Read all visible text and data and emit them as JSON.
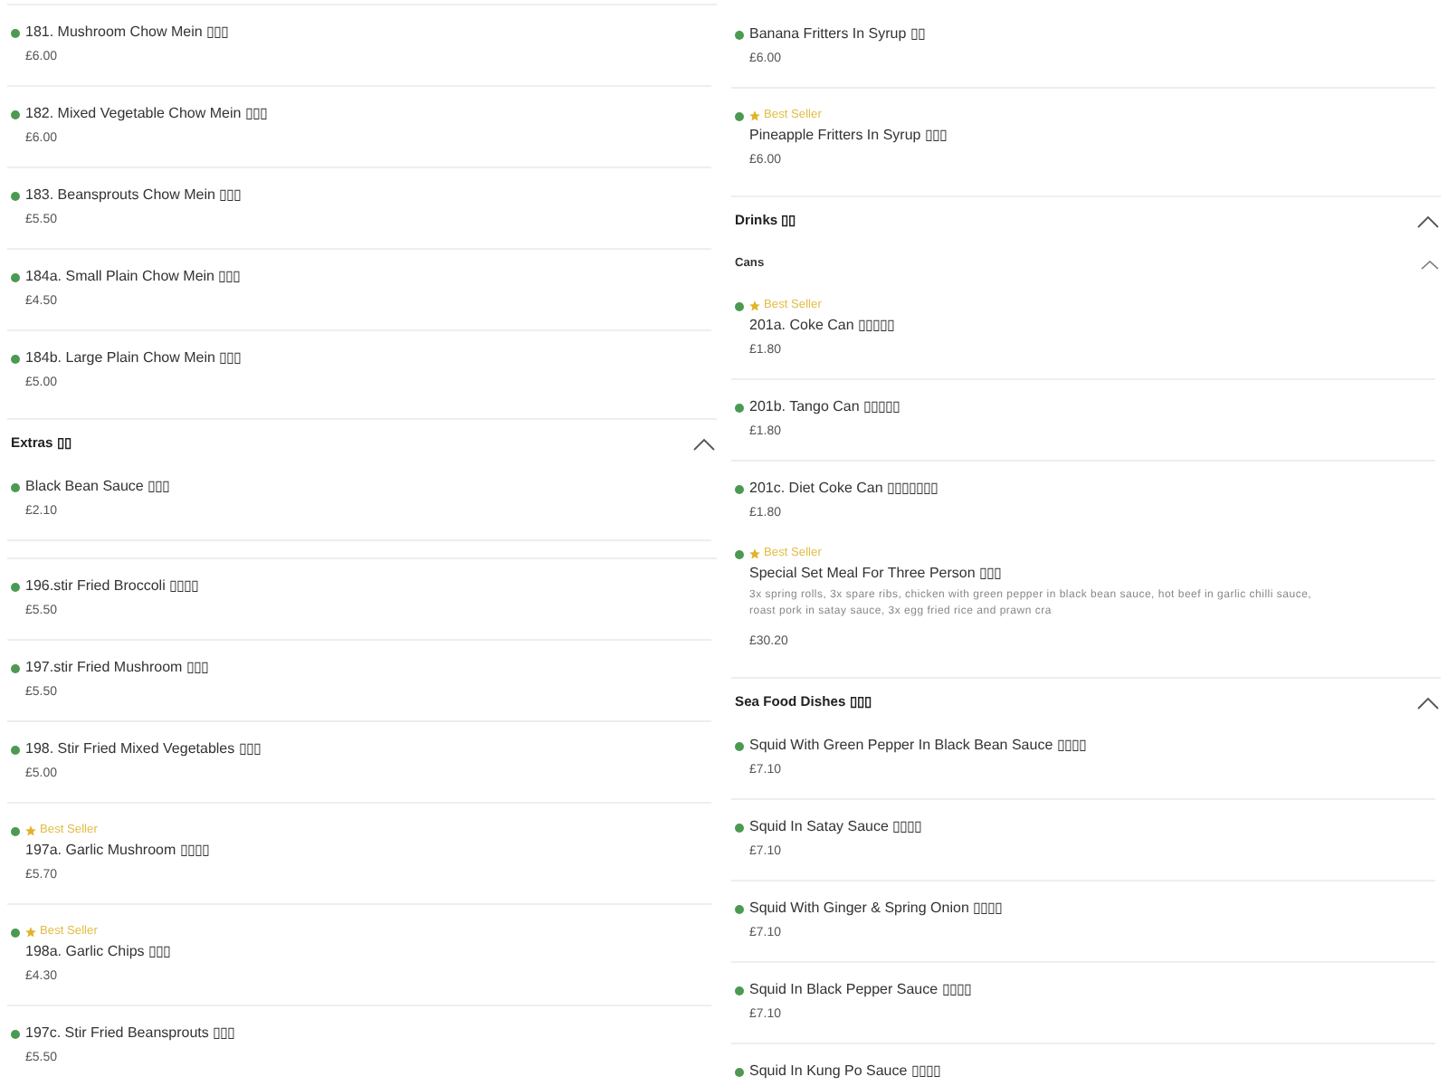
{
  "columns": [
    {
      "sections": [
        {
          "groups": [
            {
              "items": [
                {
                  "name": "181. Mushroom Chow Mein ▯▯▯",
                  "price": "£6.00"
                },
                {
                  "name": "182. Mixed Vegetable Chow Mein ▯▯▯",
                  "price": "£6.00"
                },
                {
                  "name": "183. Beansprouts Chow Mein ▯▯▯",
                  "price": "£5.50"
                },
                {
                  "name": "184a. Small Plain Chow Mein ▯▯▯",
                  "price": "£4.50"
                },
                {
                  "name": "184b. Large Plain Chow Mein ▯▯▯",
                  "price": "£5.00"
                }
              ]
            }
          ]
        },
        {
          "title": "Extras ▯▯",
          "expanded": true,
          "groups": [
            {
              "items": [
                {
                  "name": "Black Bean Sauce ▯▯▯",
                  "price": "£2.10"
                }
              ]
            },
            {
              "items": [
                {
                  "name": "196.stir Fried Broccoli ▯▯▯▯",
                  "price": "£5.50"
                },
                {
                  "name": "197.stir Fried Mushroom ▯▯▯",
                  "price": "£5.50"
                },
                {
                  "name": "198. Stir Fried Mixed Vegetables ▯▯▯",
                  "price": "£5.00"
                },
                {
                  "badge": "Best Seller",
                  "name": "197a. Garlic Mushroom ▯▯▯▯",
                  "price": "£5.70"
                },
                {
                  "badge": "Best Seller",
                  "name": "198a. Garlic Chips ▯▯▯",
                  "price": "£4.30"
                },
                {
                  "name": "197c. Stir Fried Beansprouts ▯▯▯",
                  "price": "£5.50"
                }
              ]
            }
          ]
        }
      ]
    },
    {
      "sections": [
        {
          "groups": [
            {
              "items": [
                {
                  "name": "Banana Fritters In Syrup ▯▯",
                  "price": "£6.00"
                },
                {
                  "badge": "Best Seller",
                  "name": "Pineapple Fritters In Syrup ▯▯▯",
                  "price": "£6.00"
                }
              ]
            }
          ]
        },
        {
          "title": "Drinks ▯▯",
          "expanded": true,
          "groups": [
            {
              "title": "Cans",
              "expanded": true,
              "items": [
                {
                  "badge": "Best Seller",
                  "name": "201a. Coke Can ▯▯▯▯▯",
                  "price": "£1.80"
                },
                {
                  "name": "201b. Tango Can ▯▯▯▯▯",
                  "price": "£1.80"
                },
                {
                  "name": "201c. Diet Coke Can ▯▯▯▯▯▯▯",
                  "price": "£1.80"
                }
              ]
            },
            {
              "items": [
                {
                  "badge": "Best Seller",
                  "name": "Special Set Meal For Three Person ▯▯▯",
                  "description": "3x spring rolls, 3x spare ribs, chicken with green pepper in black bean sauce, hot beef in garlic chilli sauce, roast pork in satay sauce, 3x egg fried rice and prawn cra",
                  "price": "£30.20"
                }
              ]
            }
          ]
        },
        {
          "title": "Sea Food Dishes ▯▯▯",
          "expanded": true,
          "groups": [
            {
              "items": [
                {
                  "name": "Squid With Green Pepper In Black Bean Sauce ▯▯▯▯",
                  "price": "£7.10"
                },
                {
                  "name": "Squid In Satay Sauce ▯▯▯▯",
                  "price": "£7.10"
                },
                {
                  "name": "Squid With Ginger & Spring Onion ▯▯▯▯",
                  "price": "£7.10"
                },
                {
                  "name": "Squid In Black Pepper Sauce ▯▯▯▯",
                  "price": "£7.10"
                },
                {
                  "name": "Squid In Kung Po Sauce ▯▯▯▯"
                }
              ]
            }
          ]
        }
      ]
    }
  ]
}
